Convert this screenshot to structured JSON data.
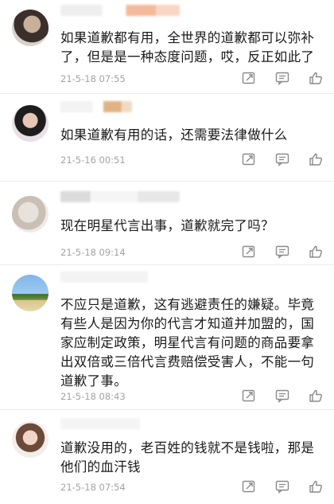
{
  "comments": [
    {
      "text": "如果道歉都有用，全世界的道歉都可以弥补了，但是是一种态度问题，哎，反正如此了",
      "time": "21-5-18 07:55"
    },
    {
      "text": "如果道歉有用的话，还需要法律做什么",
      "time": "21-5-16 00:51"
    },
    {
      "text": "现在明星代言出事，道歉就完了吗？",
      "time": "21-5-18 09:14"
    },
    {
      "text": "不应只是道歉，这有逃避责任的嫌疑。毕竟有些人是因为你的代言才知道并加盟的，国家应制定政策，明星代言有问题的商品要拿出双倍或三倍代言费赔偿受害人，不能一句道歉了事。",
      "time": "21-5-18 08:43"
    },
    {
      "text": "道歉没用的，老百姓的钱就不是钱啦，那是他们的血汗钱",
      "time": "21-5-18 07:54"
    }
  ],
  "icons": {
    "share": "share-icon",
    "comment": "comment-icon",
    "like": "like-icon"
  },
  "colors": {
    "text": "#1a1a1a",
    "timestamp": "#a3a3a3",
    "icon": "#8a8a8a",
    "divider": "#ececec"
  }
}
